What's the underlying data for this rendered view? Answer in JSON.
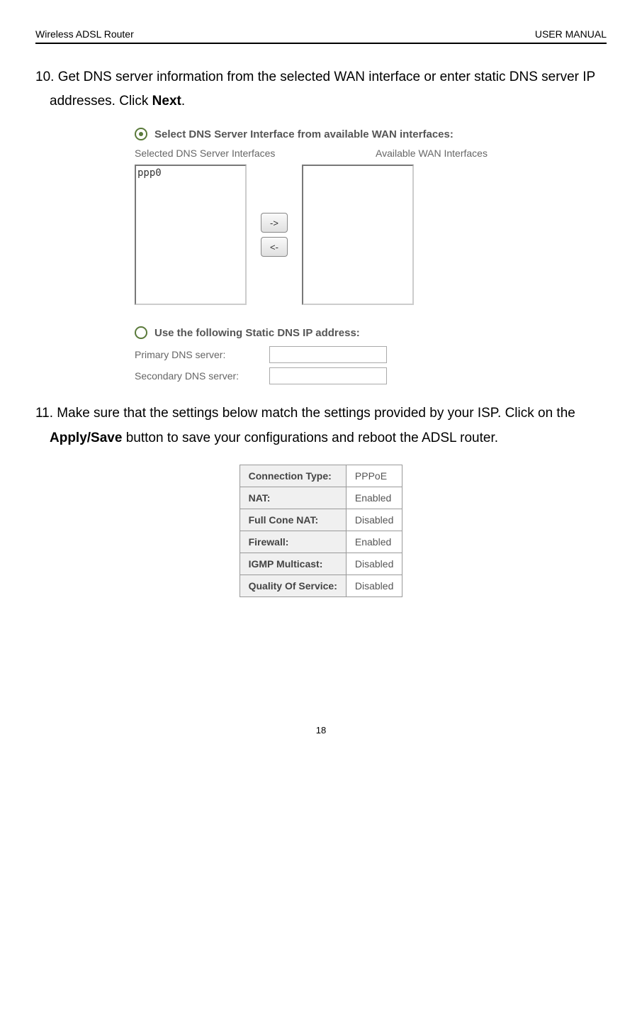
{
  "header": {
    "left": "Wireless ADSL Router",
    "right": "USER MANUAL"
  },
  "step10": {
    "number": "10.",
    "text_before": "Get DNS server information from the selected WAN interface or enter static DNS server IP addresses. Click ",
    "bold": "Next",
    "text_after": "."
  },
  "dns_screenshot": {
    "radio1_label": "Select DNS Server Interface from available WAN interfaces:",
    "selected_label": "Selected DNS Server Interfaces",
    "available_label": "Available WAN Interfaces",
    "selected_item": "ppp0",
    "btn_right": "->",
    "btn_left": "<-",
    "radio2_label": "Use the following Static DNS IP address:",
    "primary_label": "Primary DNS server:",
    "secondary_label": "Secondary DNS server:"
  },
  "step11": {
    "number": "11.",
    "text_before": "Make sure that the settings below match the settings provided by your ISP. Click on the ",
    "bold": "Apply/Save",
    "text_after": " button to save your configurations and reboot the ADSL router."
  },
  "settings_table": [
    {
      "label": "Connection Type:",
      "value": "PPPoE"
    },
    {
      "label": "NAT:",
      "value": "Enabled"
    },
    {
      "label": "Full Cone NAT:",
      "value": "Disabled"
    },
    {
      "label": "Firewall:",
      "value": "Enabled"
    },
    {
      "label": "IGMP Multicast:",
      "value": "Disabled"
    },
    {
      "label": "Quality Of Service:",
      "value": "Disabled"
    }
  ],
  "footer": {
    "page": "18"
  }
}
